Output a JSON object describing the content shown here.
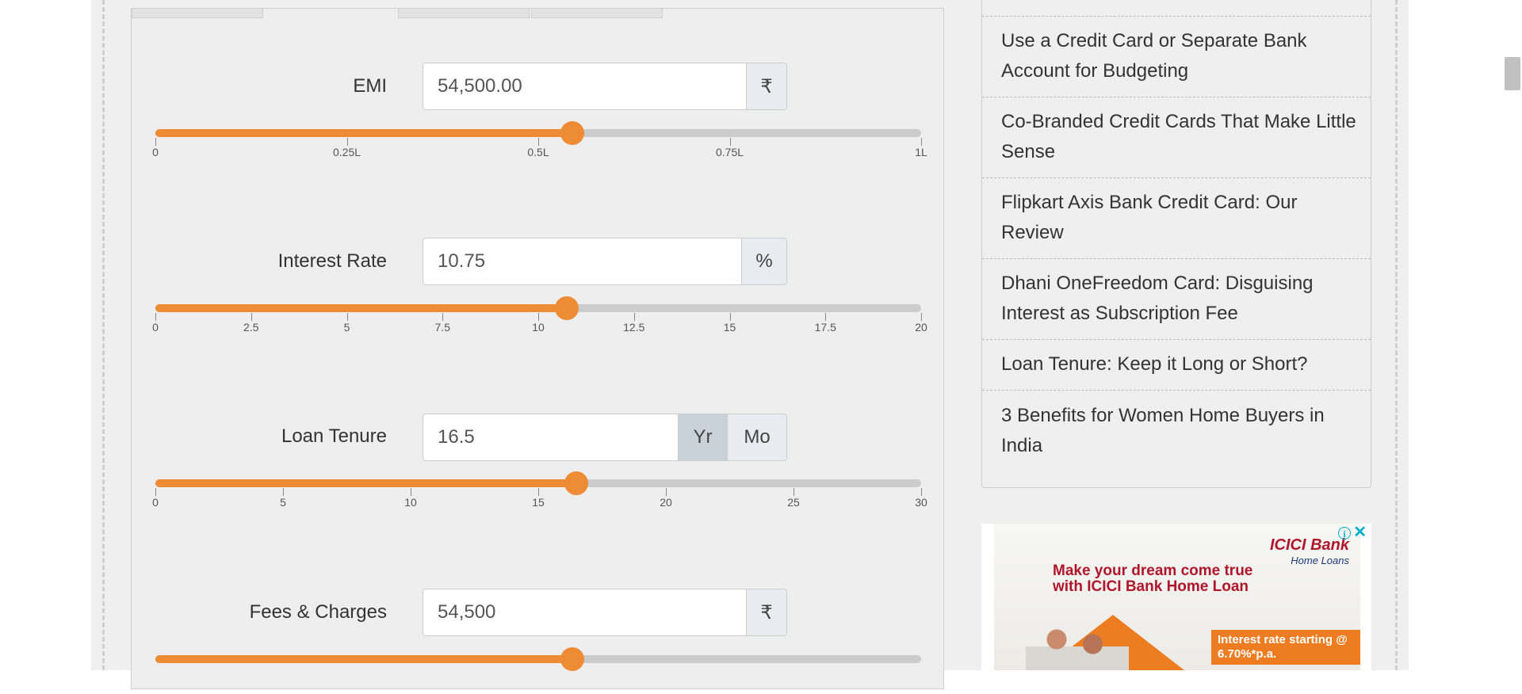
{
  "calculator": {
    "accent_color": "#ed8c34",
    "emi": {
      "label": "EMI",
      "value": "54,500.00",
      "unit": "₹",
      "slider": {
        "min": 0,
        "max": 100000,
        "value": 54500,
        "ticks": [
          0,
          25000,
          50000,
          75000,
          100000
        ],
        "tick_labels": [
          "0",
          "0.25L",
          "0.5L",
          "0.75L",
          "1L"
        ]
      }
    },
    "interest_rate": {
      "label": "Interest Rate",
      "value": "10.75",
      "unit": "%",
      "slider": {
        "min": 0,
        "max": 20,
        "value": 10.75,
        "ticks": [
          0,
          2.5,
          5,
          7.5,
          10,
          12.5,
          15,
          17.5,
          20
        ],
        "tick_labels": [
          "0",
          "2.5",
          "5",
          "7.5",
          "10",
          "12.5",
          "15",
          "17.5",
          "20"
        ]
      }
    },
    "loan_tenure": {
      "label": "Loan Tenure",
      "value": "16.5",
      "unit_year": "Yr",
      "unit_month": "Mo",
      "selected_unit": "Yr",
      "slider": {
        "min": 0,
        "max": 30,
        "value": 16.5,
        "ticks": [
          0,
          5,
          10,
          15,
          20,
          25,
          30
        ],
        "tick_labels": [
          "0",
          "5",
          "10",
          "15",
          "20",
          "25",
          "30"
        ]
      }
    },
    "fees_charges": {
      "label": "Fees & Charges",
      "value": "54,500",
      "unit": "₹",
      "slider": {
        "min": 0,
        "max": 100000,
        "value": 54500
      }
    }
  },
  "sidebar": {
    "items": [
      {
        "title": "Use a Credit Card or Separate Bank Account for Budgeting"
      },
      {
        "title": "Co-Branded Credit Cards That Make Little Sense"
      },
      {
        "title": "Flipkart Axis Bank Credit Card: Our Review"
      },
      {
        "title": "Dhani OneFreedom Card: Disguising Interest as Subscription Fee"
      },
      {
        "title": "Loan Tenure: Keep it Long or Short?"
      },
      {
        "title": "3 Benefits for Women Home Buyers in India"
      }
    ]
  },
  "ad": {
    "brand": "ICICI Bank",
    "brand_sub": "Home Loans",
    "headline": "Make your dream come true with ICICI Bank Home Loan",
    "rate_text": "Interest rate starting @ 6.70%*p.a.",
    "info_icon": "info-icon",
    "close_icon": "close-icon",
    "brand_color": "#b0162b",
    "accent_color": "#ee7d22"
  }
}
